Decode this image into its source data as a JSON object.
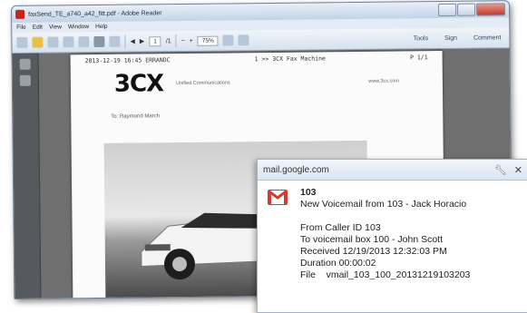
{
  "reader": {
    "title": "faxSend_TE_a740_a42_fitt.pdf - Adobe Reader",
    "menu": [
      "File",
      "Edit",
      "View",
      "Window",
      "Help"
    ],
    "toolbar": {
      "page": "1",
      "page_total": "/1",
      "zoom": "75%",
      "tools": "Tools",
      "sign": "Sign",
      "comment": "Comment"
    }
  },
  "fax_page": {
    "header_left": "2013-12-19 16:45 ERRANDC",
    "header_mid": "1 >> 3CX Fax Machine",
    "header_right": "P 1/1",
    "logo": "3CX",
    "logo_note": "Unified Communications",
    "logo_right": "www.3cx.com",
    "to_line": "To: Raymond March"
  },
  "notification": {
    "url": "mail.google.com",
    "sender": "103",
    "subject": "New Voicemail from 103 - Jack Horacio",
    "lines": [
      "From Caller ID 103",
      "To voicemail box 100 - John Scott",
      "Received 12/19/2013 12:32:03 PM",
      "Duration 00:00:02",
      "File    vmail_103_100_20131219103203"
    ]
  }
}
